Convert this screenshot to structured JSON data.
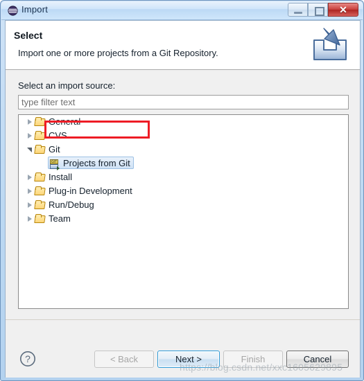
{
  "window": {
    "title": "Import",
    "icon": "eclipse-globe-icon",
    "controls": {
      "minimize": "minimize-button",
      "maximize": "maximize-button",
      "close_label": "✕"
    }
  },
  "banner": {
    "title": "Select",
    "description": "Import one or more projects from a Git Repository.",
    "icon": "import-wizard-icon"
  },
  "page": {
    "source_label": "Select an import source:",
    "filter": {
      "value": "",
      "placeholder": "type filter text"
    },
    "tree": [
      {
        "label": "General",
        "icon": "folder-icon",
        "state": "collapsed",
        "level": 0,
        "selected": false
      },
      {
        "label": "CVS",
        "icon": "folder-icon",
        "state": "collapsed",
        "level": 0,
        "selected": false
      },
      {
        "label": "Git",
        "icon": "folder-icon",
        "state": "expanded",
        "level": 0,
        "selected": false
      },
      {
        "label": "Projects from Git",
        "icon": "git-icon",
        "state": "leaf",
        "level": 1,
        "selected": true
      },
      {
        "label": "Install",
        "icon": "folder-icon",
        "state": "collapsed",
        "level": 0,
        "selected": false
      },
      {
        "label": "Plug-in Development",
        "icon": "folder-icon",
        "state": "collapsed",
        "level": 0,
        "selected": false
      },
      {
        "label": "Run/Debug",
        "icon": "folder-icon",
        "state": "collapsed",
        "level": 0,
        "selected": false
      },
      {
        "label": "Team",
        "icon": "folder-icon",
        "state": "collapsed",
        "level": 0,
        "selected": false
      }
    ],
    "git_icon_text": "GIT",
    "highlight_color": "#ee1c25"
  },
  "buttons": {
    "help": "?",
    "back": "< Back",
    "next": "Next >",
    "finish": "Finish",
    "cancel": "Cancel"
  },
  "watermark": "https://blog.csdn.net/xxc1605629895",
  "colors": {
    "title_bar": "#cfe5fa",
    "close_button": "#c9403c",
    "focus_border": "#2f9ad6",
    "folder": "#fdd67a"
  }
}
